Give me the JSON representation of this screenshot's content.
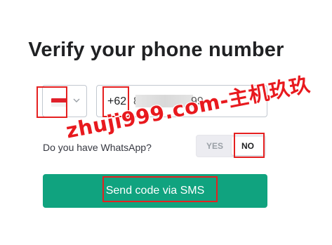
{
  "page": {
    "title": "Verify your phone number"
  },
  "phone": {
    "country_flag": "indonesia-flag",
    "prefix": "+62",
    "number_visible_start": "8",
    "number_visible_end": "99"
  },
  "whatsapp": {
    "question": "Do you have WhatsApp?",
    "options": [
      "YES",
      "NO"
    ],
    "selected": "NO"
  },
  "actions": {
    "send_label": "Send code via SMS"
  },
  "watermark": {
    "text": "zhuji999.com-主机玖玖"
  },
  "colors": {
    "accent": "#10a37f",
    "highlight": "#e52020",
    "title": "#202123"
  }
}
